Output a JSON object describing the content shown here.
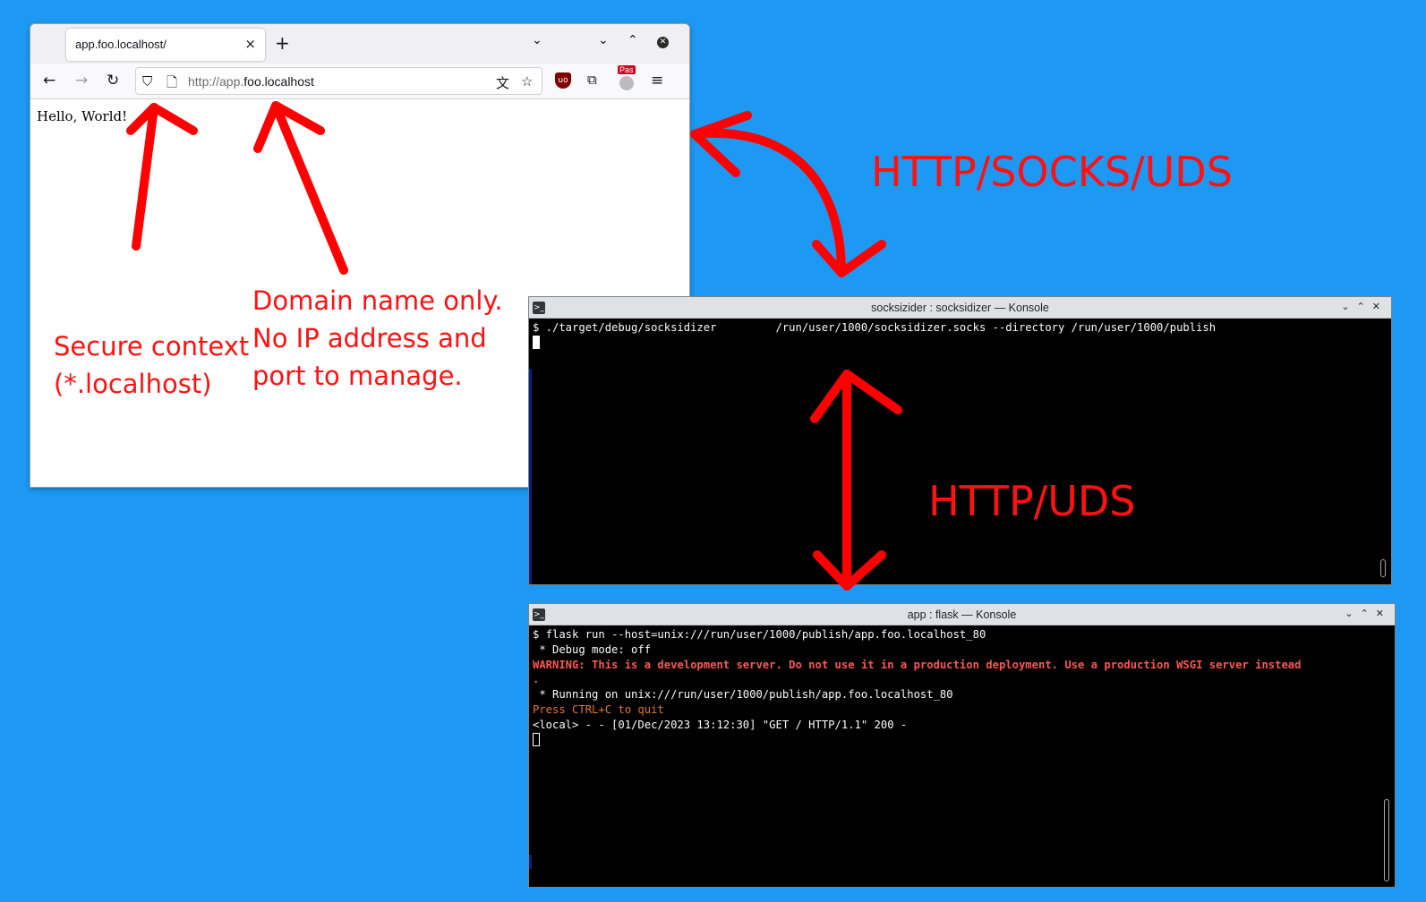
{
  "browser": {
    "tab_title": "app.foo.localhost/",
    "tab_close": "×",
    "new_tab": "+",
    "url_scheme": "http://app.",
    "url_host": "foo.localhost",
    "page_text": "Hello, World!",
    "pas_badge": "Pas",
    "icons": [
      "back-icon",
      "forward-icon",
      "reload-icon",
      "shield-icon",
      "page-icon",
      "translate-icon",
      "bookmark-star-icon",
      "ublock-icon",
      "extensions-icon",
      "account-icon",
      "menu-icon"
    ]
  },
  "terminal_top": {
    "title": "socksizider : socksidizer — Konsole",
    "lines": [
      "$ ./target/debug/socksidizer         /run/user/1000/socksidizer.socks --directory /run/user/1000/publish"
    ]
  },
  "terminal_bottom": {
    "title": "app : flask — Konsole",
    "line1": "$ flask run --host=unix:///run/user/1000/publish/app.foo.localhost_80",
    "line2": " * Debug mode: off",
    "line3": "WARNING: This is a development server. Do not use it in a production deployment. Use a production WSGI server instead",
    "line4": ".",
    "line5": " * Running on unix:///run/user/1000/publish/app.foo.localhost_80",
    "line6": "Press CTRL+C to quit",
    "line7": "<local> - - [01/Dec/2023 13:12:30] \"GET / HTTP/1.1\" 200 -"
  },
  "annotations": {
    "secure": "Secure context\n(*.localhost)",
    "domain": "Domain name only.\nNo IP address and\nport to manage.",
    "proto_top": "HTTP/SOCKS/UDS",
    "proto_mid": "HTTP/UDS"
  },
  "colors": {
    "desktop": "#1d99f3",
    "annotation": "#ff1111",
    "warning": "#ff5555",
    "hint": "#e3772d"
  }
}
